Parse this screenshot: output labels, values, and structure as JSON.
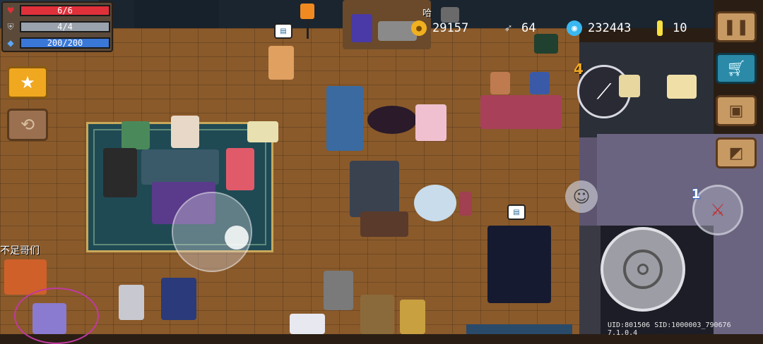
{
  "hud": {
    "hp": {
      "text": "6/6",
      "fraction": 1.0,
      "icon": "heart-icon",
      "color": "#e0303a"
    },
    "armor": {
      "text": "4/4",
      "fraction": 1.0,
      "icon": "shield-icon",
      "color": "#9aa2ad"
    },
    "energy": {
      "text": "200/200",
      "fraction": 1.0,
      "icon": "diamond-icon",
      "color": "#3a78d8"
    }
  },
  "currency": {
    "gold": {
      "value": "29157",
      "icon": "coin-icon",
      "color": "#f0b020"
    },
    "material": {
      "value": "64",
      "icon": "feather-icon"
    },
    "gems": {
      "value": "232443",
      "icon": "gem-icon",
      "color": "#3ab8f0"
    },
    "tokens": {
      "value": "10",
      "icon": "token-icon",
      "color": "#f8e040"
    }
  },
  "weapon": {
    "slot_badge": "4",
    "icon": "sword-icon"
  },
  "secondary_weapon": {
    "badge": "1",
    "icon": "swap-weapon-icon"
  },
  "player_tag": "不足哥们",
  "npc_tag": "哈",
  "footer": {
    "uid_text": "UID:801506 SID:1000003_790676 7.1.0.4"
  },
  "buttons": {
    "pause": "pause-icon",
    "shop": "cart-icon",
    "profile": "card-icon",
    "map": "map-icon",
    "skill": "star-icon",
    "switch": "cycle-icon",
    "emote": "smile-icon",
    "attack": "crosshair-icon"
  }
}
